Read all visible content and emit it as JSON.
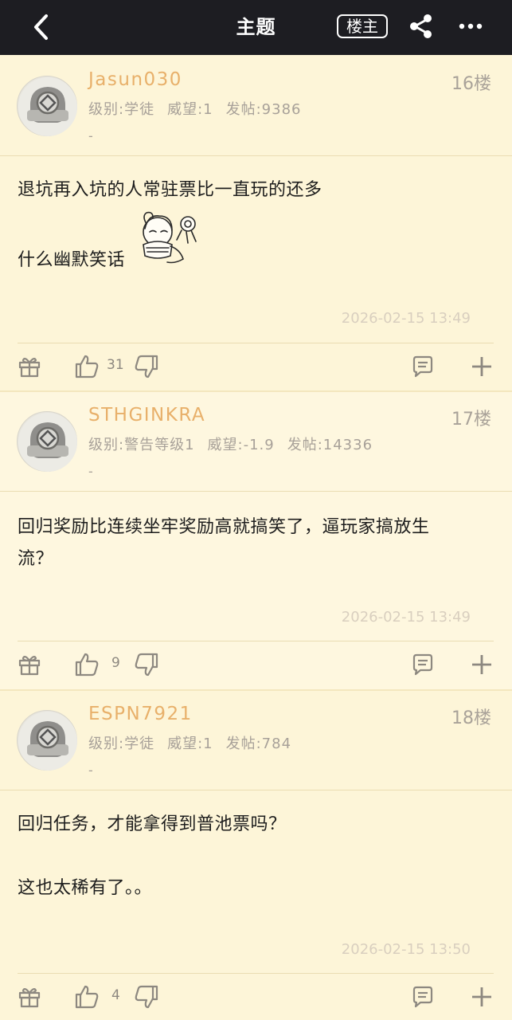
{
  "header": {
    "title": "主题",
    "op_button": "楼主"
  },
  "posts": [
    {
      "username": "Jasun030",
      "floor": "16楼",
      "level": "级别:学徒",
      "prestige": "威望:1",
      "post_count": "发帖:9386",
      "signature": "-",
      "lines": [
        "退坑再入坑的人常驻票比一直玩的还多",
        "什么幽默笑话"
      ],
      "timestamp": "2026-02-15 13:49",
      "likes": "31"
    },
    {
      "username": "STHGINKRA",
      "floor": "17楼",
      "level": "级别:警告等级1",
      "prestige": "威望:-1.9",
      "post_count": "发帖:14336",
      "signature": "-",
      "lines": [
        "回归奖励比连续坐牢奖励高就搞笑了，逼玩家搞放生",
        "流？"
      ],
      "timestamp": "2026-02-15 13:49",
      "likes": "9"
    },
    {
      "username": "ESPN7921",
      "floor": "18楼",
      "level": "级别:学徒",
      "prestige": "威望:1",
      "post_count": "发帖:784",
      "signature": "-",
      "lines": [
        "回归任务，才能拿得到普池票吗？",
        "这也太稀有了。。"
      ],
      "timestamp": "2026-02-15 13:50",
      "likes": "4"
    }
  ],
  "colors": {
    "topbar": "#1d1d22",
    "username": "#e8b06a",
    "background": "#f9eac1"
  }
}
